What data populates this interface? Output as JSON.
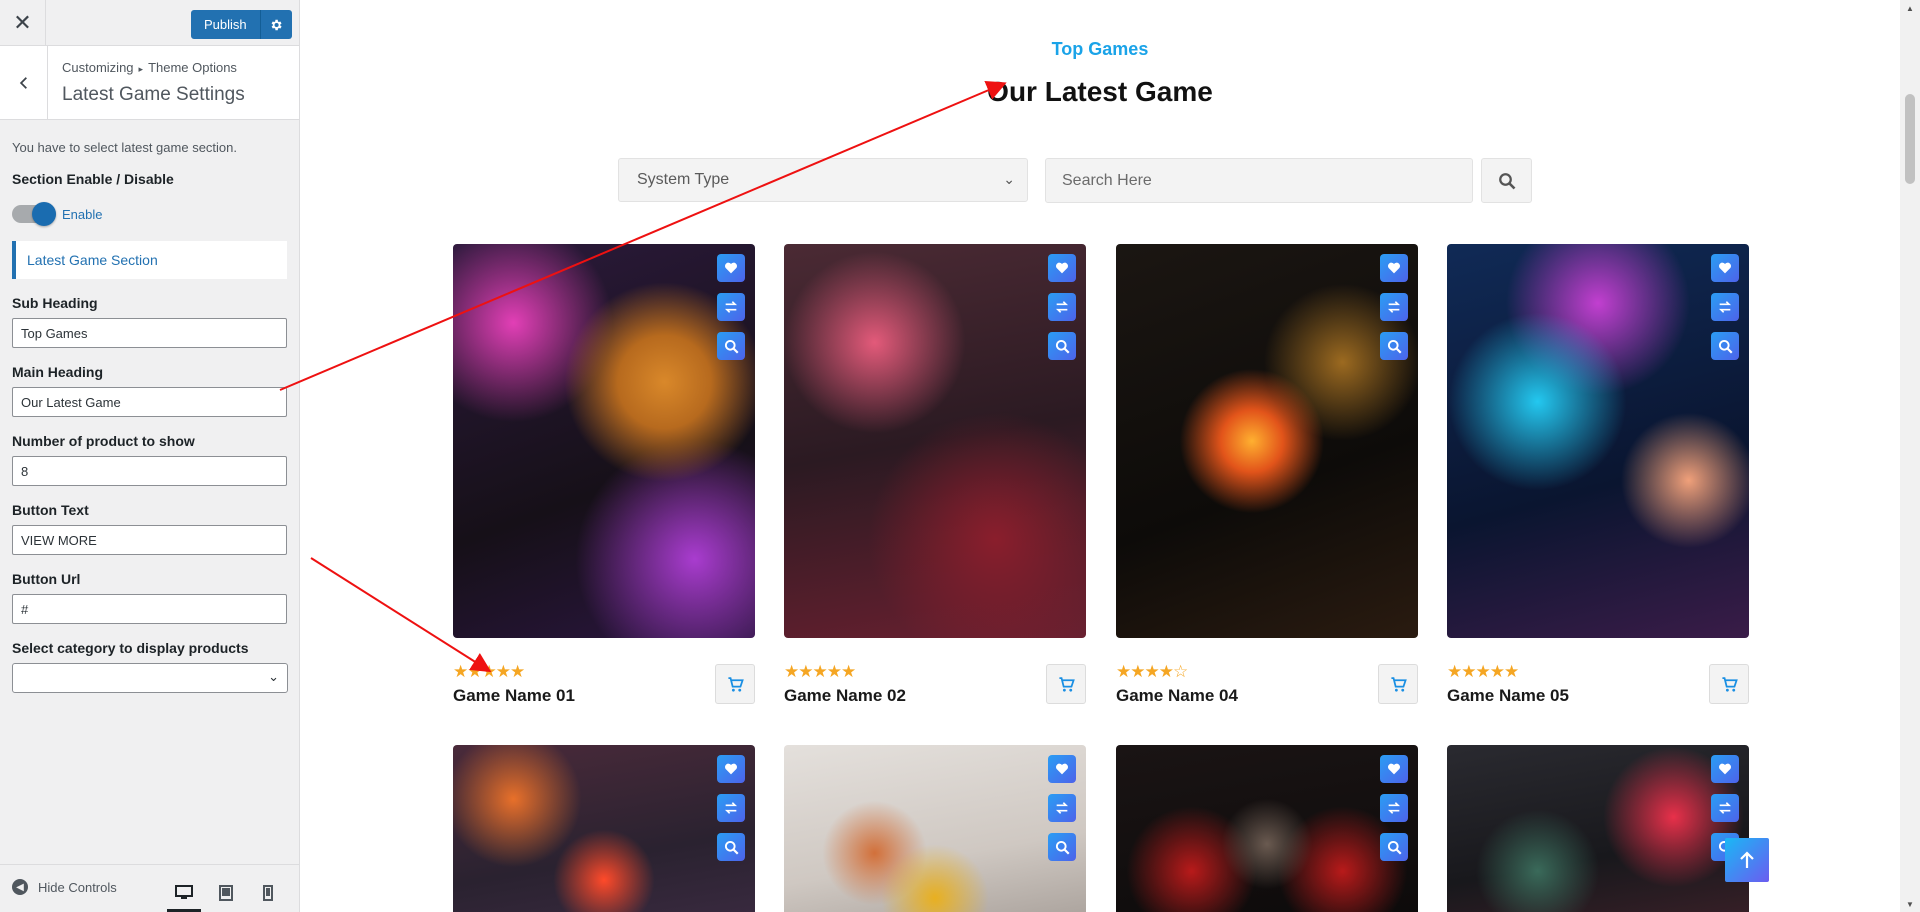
{
  "customizer": {
    "close_icon": "close-icon",
    "publish_label": "Publish",
    "breadcrumb": {
      "root": "Customizing",
      "separator": "▸",
      "parent": "Theme Options"
    },
    "panel_title": "Latest Game Settings",
    "description": "You have to select latest game section.",
    "section_toggle": {
      "label": "Section Enable / Disable",
      "state_text": "Enable",
      "enabled": true
    },
    "section_heading": "Latest Game Section",
    "fields": {
      "sub_heading": {
        "label": "Sub Heading",
        "value": "Top Games"
      },
      "main_heading": {
        "label": "Main Heading",
        "value": "Our Latest Game"
      },
      "product_count": {
        "label": "Number of product to show",
        "value": "8"
      },
      "button_text": {
        "label": "Button Text",
        "value": "VIEW MORE"
      },
      "button_url": {
        "label": "Button Url",
        "value": "#"
      },
      "category": {
        "label": "Select category to display products",
        "value": ""
      }
    },
    "footer": {
      "hide_controls": "Hide Controls",
      "devices": [
        "desktop-icon",
        "tablet-icon",
        "mobile-icon"
      ],
      "active_device": "desktop"
    }
  },
  "preview": {
    "sub_heading": "Top Games",
    "main_heading": "Our Latest Game",
    "filter": {
      "selected": "System Type"
    },
    "search": {
      "placeholder": "Search Here"
    },
    "colors": {
      "accent": "#1aa3e8",
      "star": "#f5a623",
      "action_start": "#2a9df4",
      "action_end": "#4d63ea"
    },
    "games": [
      {
        "name": "Game Name 01",
        "rating": 5
      },
      {
        "name": "Game Name 02",
        "rating": 5
      },
      {
        "name": "Game Name 04",
        "rating": 4
      },
      {
        "name": "Game Name 05",
        "rating": 5
      }
    ],
    "games_row2": [
      {},
      {},
      {},
      {}
    ]
  }
}
